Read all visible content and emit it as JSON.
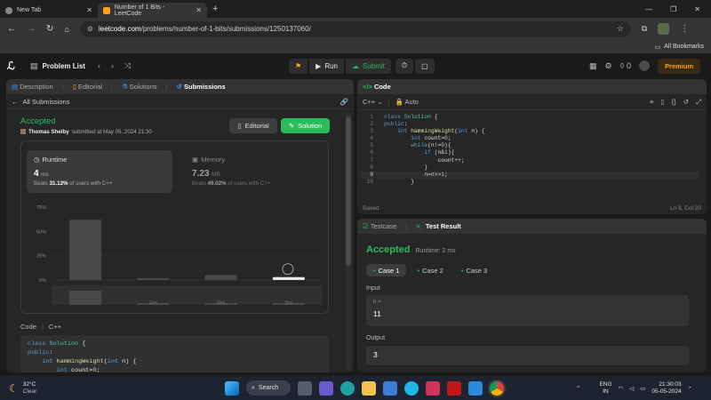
{
  "browser": {
    "tabs": [
      {
        "title": "New Tab"
      },
      {
        "title": "Number of 1 Bits - LeetCode"
      }
    ],
    "url_host": "leetcode.com",
    "url_path": "/problems/number-of-1-bits/submissions/1250137060/",
    "bookmarks_label": "All Bookmarks"
  },
  "nav": {
    "problem_list": "Problem List",
    "run": "Run",
    "submit": "Submit",
    "streak_count": "0",
    "premium": "Premium"
  },
  "left": {
    "tabs": [
      "Description",
      "Editorial",
      "Solutions",
      "Submissions"
    ],
    "back_label": "All Submissions",
    "status": "Accepted",
    "user": "Thomas Shelby",
    "submitted": "submitted at May 05, 2024 21:30",
    "editorial_btn": "Editorial",
    "solution_btn": "Solution",
    "runtime": {
      "label": "Runtime",
      "value": "4",
      "unit": "ms",
      "beats_prefix": "Beats",
      "beats_pct": "31.12%",
      "beats_suffix": "of users with C++"
    },
    "memory": {
      "label": "Memory",
      "value": "7.23",
      "unit": "MB",
      "beats_prefix": "Beats",
      "beats_pct": "49.02%",
      "beats_suffix": "of users with C++"
    },
    "code_label": "Code",
    "lang": "C++",
    "code_lines": [
      "class Solution {",
      "public:",
      "    int hammingWeight(int n) {",
      "        int count=0;"
    ]
  },
  "chart_data": {
    "type": "bar",
    "categories": [
      "0ms",
      "1ms",
      "2ms",
      "3ms"
    ],
    "tick_labels": [
      "",
      "1ms",
      "2ms",
      "3ms"
    ],
    "values": [
      62,
      2,
      5,
      3
    ],
    "yticks": [
      "75%",
      "50%",
      "25%",
      "0%"
    ],
    "ylim": [
      0,
      75
    ],
    "highlight_category": "3ms"
  },
  "editor": {
    "title": "Code",
    "lang": "C++",
    "auto": "Auto",
    "lines": [
      "class Solution {",
      "public:",
      "    int hammingWeight(int n) {",
      "        int count=0;",
      "        while(n!=0){",
      "            if (n&1){",
      "                count++;",
      "            }",
      "            n=n>>1;",
      "        }"
    ],
    "saved": "Saved",
    "cursor": "Ln 9, Col 20"
  },
  "result": {
    "tab_testcase": "Testcase",
    "tab_result": "Test Result",
    "status": "Accepted",
    "runtime": "Runtime: 2 ms",
    "cases": [
      "Case 1",
      "Case 2",
      "Case 3"
    ],
    "input_label": "Input",
    "input_var": "n =",
    "input_value": "11",
    "output_label": "Output",
    "output_value": "3"
  },
  "taskbar": {
    "temp": "32°C",
    "weather": "Clear",
    "search": "Search",
    "lang1": "ENG",
    "lang2": "IN",
    "time": "21:30:03",
    "date": "05-05-2024"
  },
  "colors": {
    "accent_green": "#2cbb5d",
    "leetcode_orange": "#ffa116",
    "link_blue": "#3e95e8"
  }
}
